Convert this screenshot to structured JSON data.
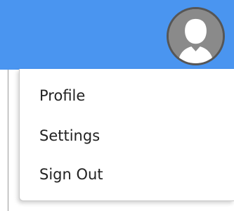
{
  "header": {
    "background_color": "#4a95f0",
    "avatar": {
      "icon": "user-avatar-icon"
    }
  },
  "menu": {
    "items": [
      {
        "label": "Profile"
      },
      {
        "label": "Settings"
      },
      {
        "label": "Sign Out"
      }
    ]
  }
}
